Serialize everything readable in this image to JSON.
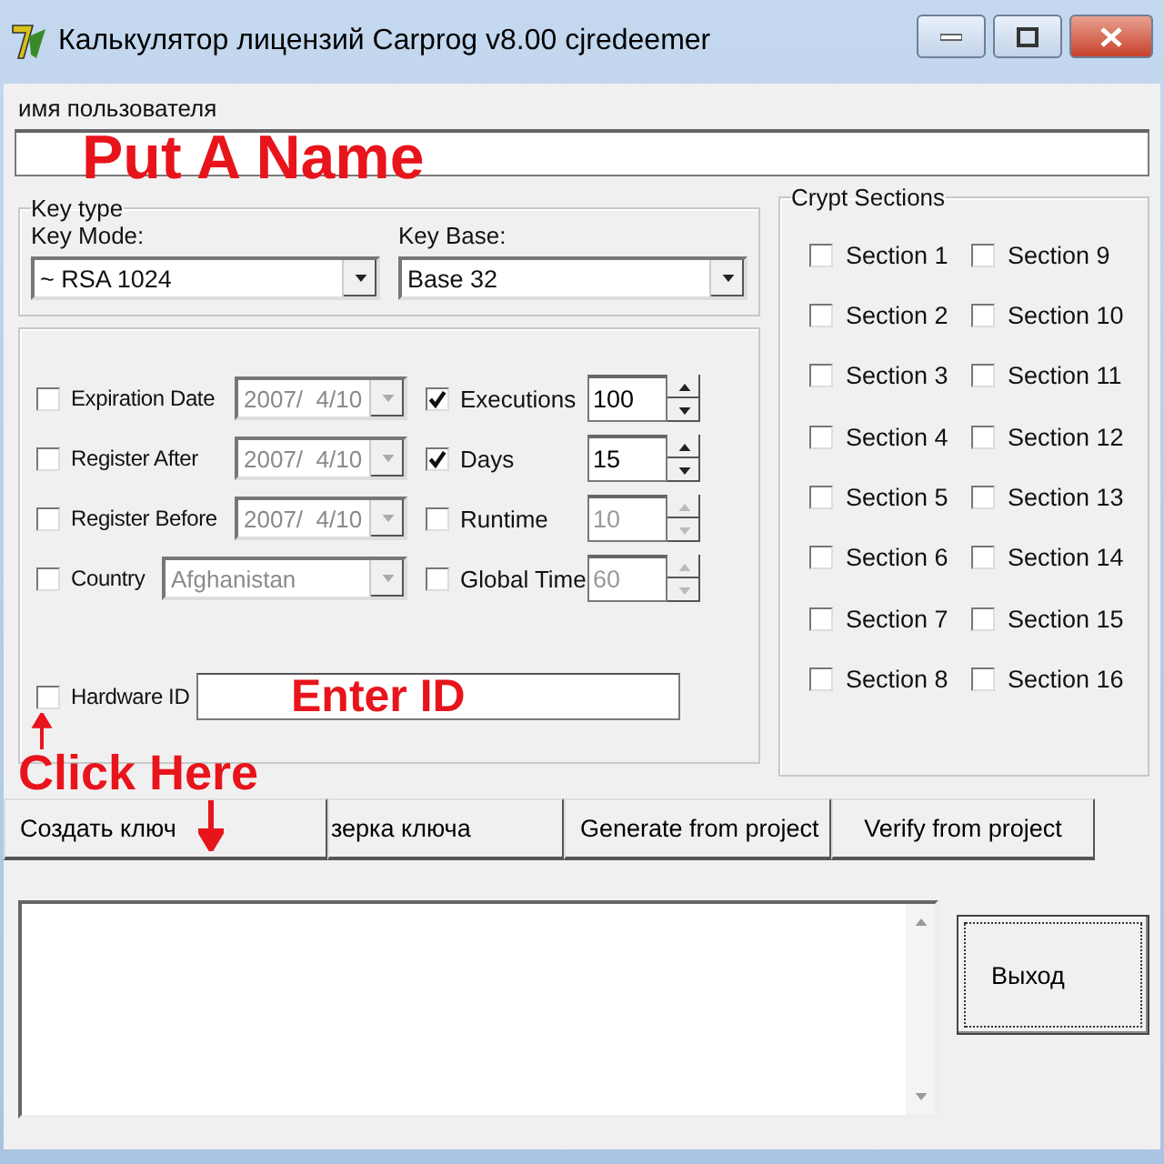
{
  "window": {
    "title": "Калькулятор лицензий Carprog v8.00 cjredeemer"
  },
  "username": {
    "label": "имя пользователя"
  },
  "key_type": {
    "title": "Key type",
    "key_mode": {
      "label": "Key Mode:",
      "value": "~ RSA 1024"
    },
    "key_base": {
      "label": "Key Base:",
      "value": "Base 32"
    }
  },
  "options": [
    {
      "kind": "date",
      "label": "Expiration Date",
      "checked": false,
      "value": "2007/  4/10"
    },
    {
      "kind": "date",
      "label": "Register After",
      "checked": false,
      "value": "2007/  4/10"
    },
    {
      "kind": "date",
      "label": "Register Before",
      "checked": false,
      "value": "2007/  4/10"
    },
    {
      "kind": "country",
      "label": "Country",
      "checked": false,
      "value": "Afghanistan"
    }
  ],
  "counters": [
    {
      "label": "Executions",
      "checked": true,
      "value": "100"
    },
    {
      "label": "Days",
      "checked": true,
      "value": "15"
    },
    {
      "label": "Runtime",
      "checked": false,
      "value": "10"
    },
    {
      "label": "Global Time",
      "checked": false,
      "value": "60"
    }
  ],
  "hardware_id": {
    "label": "Hardware ID",
    "checked": false
  },
  "crypt_sections": {
    "title": "Crypt Sections",
    "items": [
      {
        "label": "Section 1",
        "checked": false
      },
      {
        "label": "Section 2",
        "checked": false
      },
      {
        "label": "Section 3",
        "checked": false
      },
      {
        "label": "Section 4",
        "checked": false
      },
      {
        "label": "Section 5",
        "checked": false
      },
      {
        "label": "Section 6",
        "checked": false
      },
      {
        "label": "Section 7",
        "checked": false
      },
      {
        "label": "Section 8",
        "checked": false
      },
      {
        "label": "Section 9",
        "checked": false
      },
      {
        "label": "Section 10",
        "checked": false
      },
      {
        "label": "Section 11",
        "checked": false
      },
      {
        "label": "Section 12",
        "checked": false
      },
      {
        "label": "Section 13",
        "checked": false
      },
      {
        "label": "Section 14",
        "checked": false
      },
      {
        "label": "Section 15",
        "checked": false
      },
      {
        "label": "Section 16",
        "checked": false
      }
    ]
  },
  "buttons": [
    "Создать ключ",
    "зерка ключа",
    "Generate from project",
    "Verify from project"
  ],
  "exit_button": "Выход",
  "annotations": [
    "Put A Name",
    "Enter ID",
    "Click Here"
  ]
}
